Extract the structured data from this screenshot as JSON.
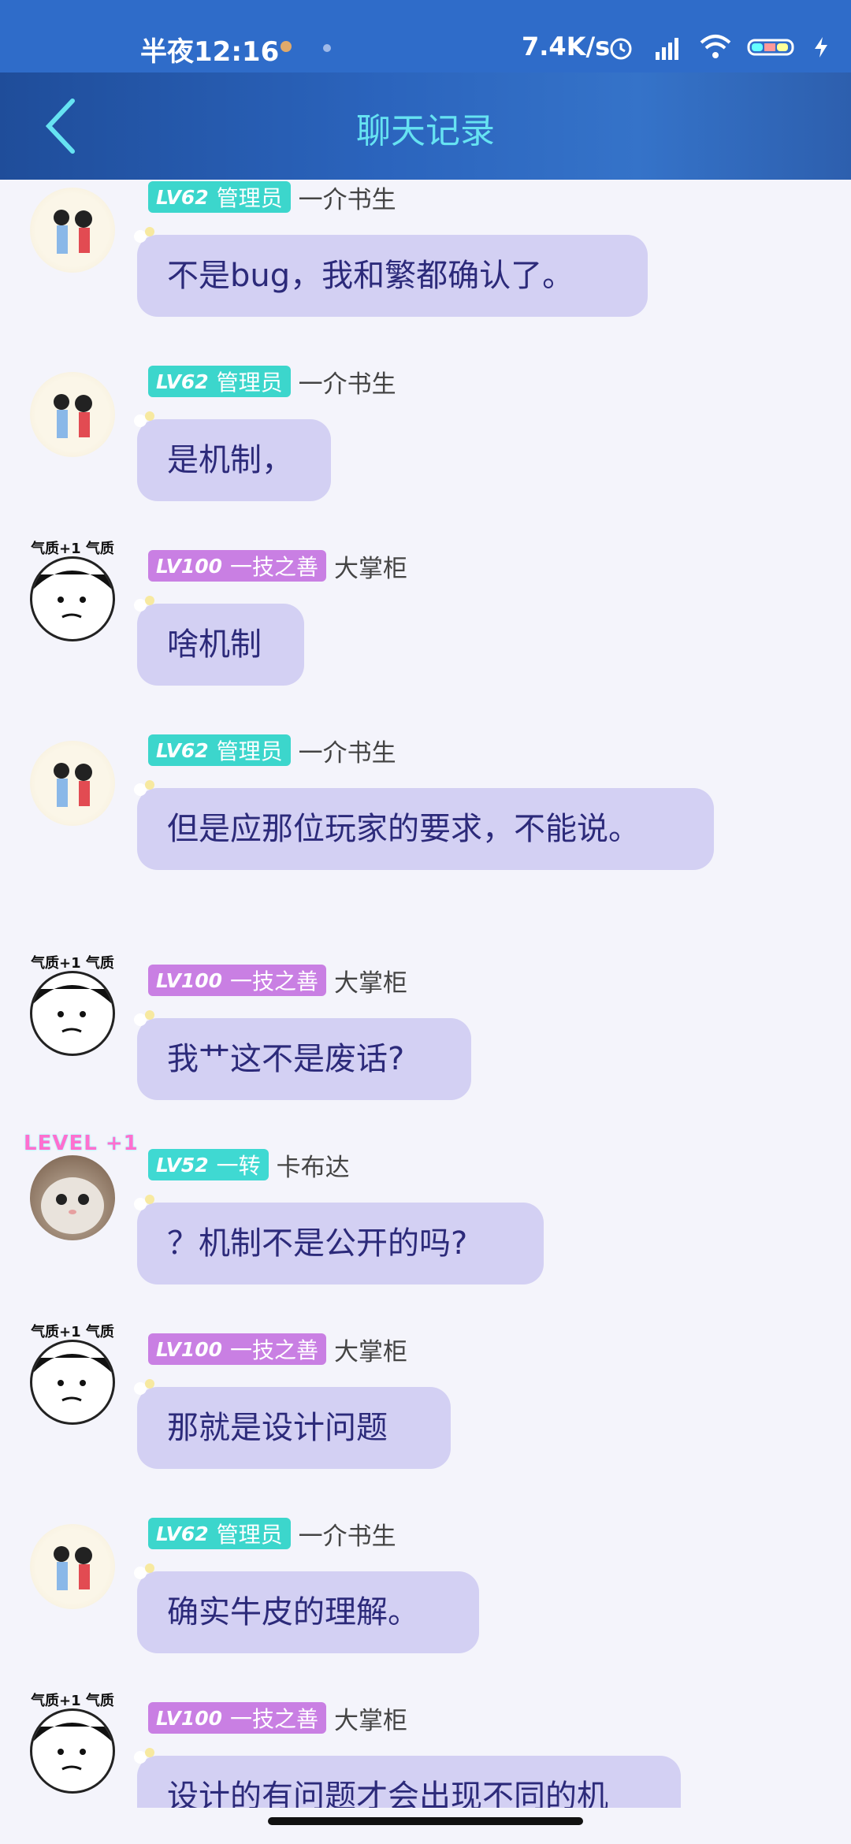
{
  "status_bar": {
    "time": "半夜12:16",
    "net_speed": "7.4K/s",
    "icons": [
      "alarm-icon",
      "hd-signal-icon",
      "wifi-icon",
      "battery-icon",
      "charging-icon"
    ]
  },
  "header": {
    "title": "聊天记录",
    "back_icon": "back-arrow-icon"
  },
  "colors": {
    "header_title": "#66e3f2",
    "bubble": "#d3d0f3",
    "bubble_text": "#2c2a7a",
    "badge_admin": "#3cd6cc",
    "badge_skill": "#c97fe3"
  },
  "messages": [
    {
      "level": "LV62",
      "title": "管理员",
      "name": "一介书生",
      "text": "不是bug，我和繁都确认了。"
    },
    {
      "level": "LV62",
      "title": "管理员",
      "name": "一介书生",
      "text": "是机制，"
    },
    {
      "level": "LV100",
      "title": "一技之善",
      "name": "大掌柜",
      "text": "啥机制",
      "avatar_tag": "气质+1 气质+1"
    },
    {
      "level": "LV62",
      "title": "管理员",
      "name": "一介书生",
      "text": "但是应那位玩家的要求，不能说。"
    },
    {
      "level": "LV100",
      "title": "一技之善",
      "name": "大掌柜",
      "text": "我艹这不是废话?",
      "avatar_tag": "气质+1 气质+1"
    },
    {
      "level": "LV52",
      "title": "一转",
      "name": "卡布达",
      "text": "？机制不是公开的吗?",
      "avatar_tag": "LEVEL +1"
    },
    {
      "level": "LV100",
      "title": "一技之善",
      "name": "大掌柜",
      "text": "那就是设计问题",
      "avatar_tag": "气质+1 气质+1"
    },
    {
      "level": "LV62",
      "title": "管理员",
      "name": "一介书生",
      "text": "确实牛皮的理解。"
    },
    {
      "level": "LV100",
      "title": "一技之善",
      "name": "大掌柜",
      "text": "设计的有问题才会出现不同的机",
      "avatar_tag": "气质+1 气质+1"
    }
  ]
}
